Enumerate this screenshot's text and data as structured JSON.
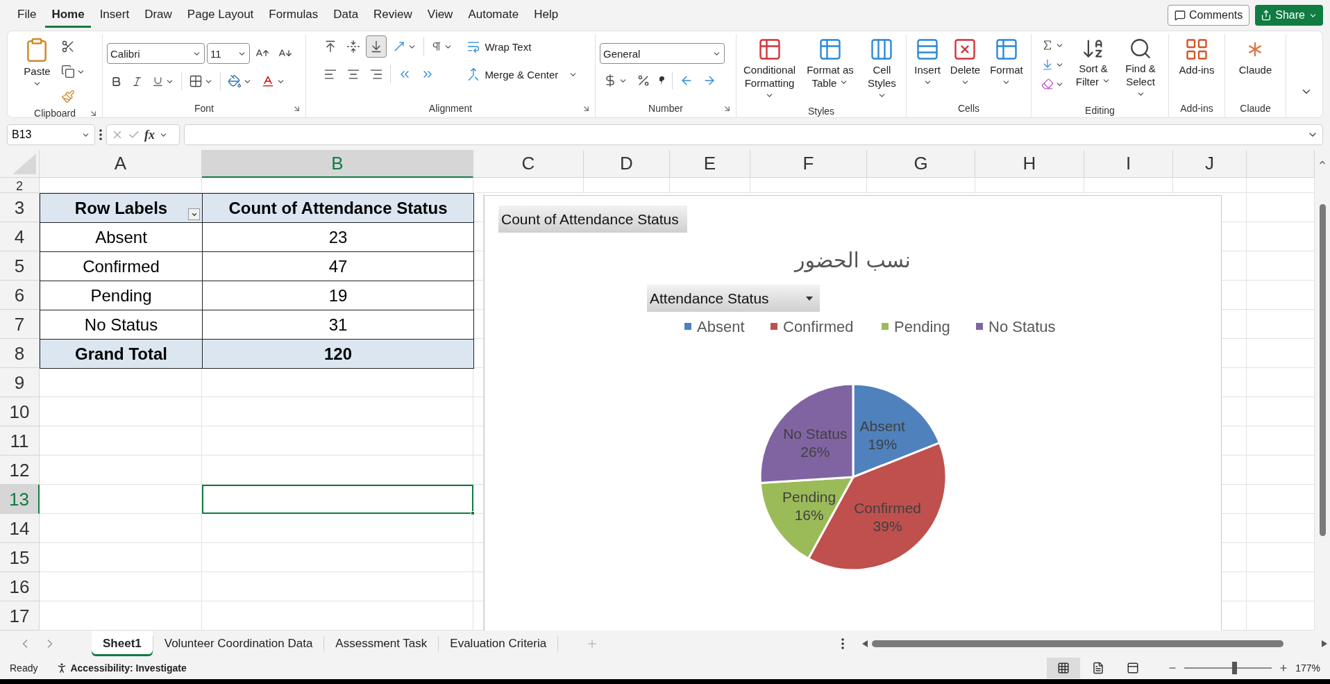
{
  "menu": [
    {
      "label": "File",
      "selected": false
    },
    {
      "label": "Home",
      "selected": true
    },
    {
      "label": "Insert",
      "selected": false
    },
    {
      "label": "Draw",
      "selected": false
    },
    {
      "label": "Page Layout",
      "selected": false
    },
    {
      "label": "Formulas",
      "selected": false
    },
    {
      "label": "Data",
      "selected": false
    },
    {
      "label": "Review",
      "selected": false
    },
    {
      "label": "View",
      "selected": false
    },
    {
      "label": "Automate",
      "selected": false
    },
    {
      "label": "Help",
      "selected": false
    }
  ],
  "actions": {
    "comments": "Comments",
    "share": "Share"
  },
  "ribbon": {
    "clipboard": {
      "paste": "Paste",
      "label": "Clipboard"
    },
    "font": {
      "name": "Calibri",
      "size": "11",
      "label": "Font"
    },
    "alignment": {
      "vertical_align": [
        {
          "selected": false
        },
        {
          "selected": false
        },
        {
          "selected": true
        }
      ],
      "wrap": "Wrap Text",
      "merge": "Merge & Center",
      "label": "Alignment"
    },
    "number": {
      "format": "General",
      "label": "Number"
    },
    "styles": {
      "buttons": [
        "Conditional Formatting",
        "Format as Table",
        "Cell Styles"
      ],
      "label": "Styles"
    },
    "cells": {
      "buttons": [
        "Insert",
        "Delete",
        "Format"
      ],
      "label": "Cells"
    },
    "editing": {
      "buttons": [
        "Sort & Filter",
        "Find & Select"
      ],
      "label": "Editing"
    },
    "addins": {
      "button": "Add-ins",
      "label": "Add-ins"
    },
    "claude": {
      "button": "Claude",
      "label": "Claude"
    }
  },
  "formula_bar": {
    "name_box": "B13",
    "function_label": "fx"
  },
  "columns": [
    {
      "label": "A",
      "selected": false
    },
    {
      "label": "B",
      "selected": true
    },
    {
      "label": "C",
      "selected": false
    },
    {
      "label": "D",
      "selected": false
    },
    {
      "label": "E",
      "selected": false
    },
    {
      "label": "F",
      "selected": false
    },
    {
      "label": "G",
      "selected": false
    },
    {
      "label": "H",
      "selected": false
    },
    {
      "label": "I",
      "selected": false
    },
    {
      "label": "J",
      "selected": false
    }
  ],
  "rows": [
    {
      "label": "2",
      "selected": false
    },
    {
      "label": "3",
      "selected": false
    },
    {
      "label": "4",
      "selected": false
    },
    {
      "label": "5",
      "selected": false
    },
    {
      "label": "6",
      "selected": false
    },
    {
      "label": "7",
      "selected": false
    },
    {
      "label": "8",
      "selected": false
    },
    {
      "label": "9",
      "selected": false
    },
    {
      "label": "10",
      "selected": false
    },
    {
      "label": "11",
      "selected": false
    },
    {
      "label": "12",
      "selected": false
    },
    {
      "label": "13",
      "selected": true
    },
    {
      "label": "14",
      "selected": false
    },
    {
      "label": "15",
      "selected": false
    },
    {
      "label": "16",
      "selected": false
    },
    {
      "label": "17",
      "selected": false
    }
  ],
  "pivot": {
    "header": [
      "Row Labels",
      "Count of Attendance Status"
    ],
    "rows": [
      {
        "label": "Absent",
        "value": "23"
      },
      {
        "label": "Confirmed",
        "value": "47"
      },
      {
        "label": "Pending",
        "value": "19"
      },
      {
        "label": "No Status",
        "value": "31"
      }
    ],
    "total": {
      "label": "Grand Total",
      "value": "120"
    }
  },
  "chart": {
    "field_button": "Count of Attendance Status",
    "filter_button": "Attendance Status",
    "legend_items": [
      {
        "label": "Absent",
        "color": "#4f81bd"
      },
      {
        "label": "Confirmed",
        "color": "#c0504d"
      },
      {
        "label": "Pending",
        "color": "#9bbb59"
      },
      {
        "label": "No Status",
        "color": "#8064a2"
      }
    ],
    "chart_data": {
      "type": "pie",
      "title": "نسب الحضور",
      "categories": [
        "Absent",
        "Confirmed",
        "Pending",
        "No Status"
      ],
      "colors": [
        "#4f81bd",
        "#c0504d",
        "#9bbb59",
        "#8064a2"
      ],
      "series": [
        {
          "values": [
            19,
            39,
            16,
            26
          ]
        }
      ],
      "value_labels": [
        "19%",
        "39%",
        "16%",
        "26%"
      ]
    }
  },
  "sheets": [
    {
      "label": "Sheet1",
      "selected": true
    },
    {
      "label": "Volunteer Coordination Data",
      "selected": false
    },
    {
      "label": "Assessment Task",
      "selected": false
    },
    {
      "label": "Evaluation Criteria",
      "selected": false
    }
  ],
  "status": {
    "mode": "Ready",
    "accessibility": "Accessibility: Investigate",
    "views": [
      {
        "selected": true
      },
      {
        "selected": false
      },
      {
        "selected": false
      }
    ],
    "zoom_slider": {
      "level": 0.57
    },
    "zoom": "177%"
  }
}
